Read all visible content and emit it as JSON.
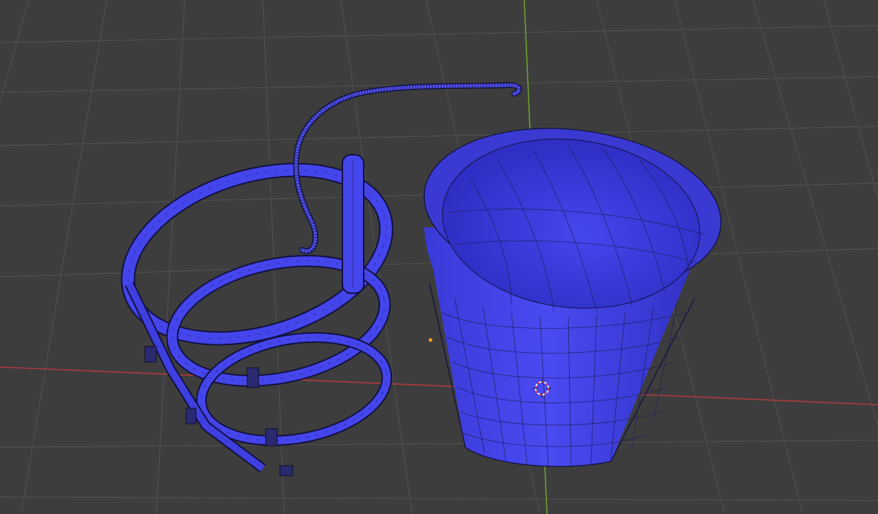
{
  "viewport": {
    "background_color": "#3d3d3d",
    "grid_color": "#4f4f4f",
    "x_axis_color": "#b33a3a",
    "y_axis_color": "#6fa030"
  },
  "mesh": {
    "face_color": "#4444ee",
    "face_shade_color": "#2f2fc0",
    "wire_color": "#1c1c55"
  },
  "objects": {
    "bucket": {
      "name": "bucket"
    },
    "handle_cord": {
      "name": "handle-cord"
    },
    "strap_holder": {
      "name": "strap-holder"
    }
  },
  "overlays": {
    "cursor_icon": "3d-cursor-icon",
    "origin_icon": "origin-point-icon",
    "cursor_color": "#e04040",
    "origin_color": "#ff9a1a"
  }
}
